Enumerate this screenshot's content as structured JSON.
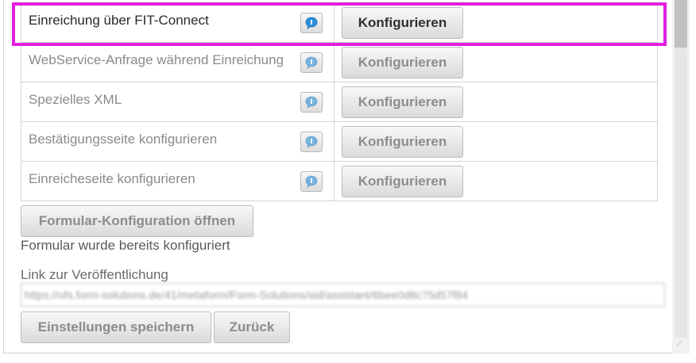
{
  "rows": [
    {
      "label": "Einreichung über FIT-Connect",
      "button": "Konfigurieren"
    },
    {
      "label": "WebService-Anfrage während Einreichung",
      "button": "Konfigurieren"
    },
    {
      "label": "Spezielles XML",
      "button": "Konfigurieren"
    },
    {
      "label": "Bestätigungsseite konfigurieren",
      "button": "Konfigurieren"
    },
    {
      "label": "Einreicheseite konfigurieren",
      "button": "Konfigurieren"
    }
  ],
  "form_config_button": "Formular-Konfiguration öffnen",
  "status_text": "Formular wurde bereits konfiguriert",
  "link": {
    "label": "Link zur Veröffentlichung",
    "value": "https://ofs.form-solutions.de/41/metaform/Form-Solutions/sid/assistant/6bee0d8c75d57f84"
  },
  "footer": {
    "save_label": "Einstellungen speichern",
    "back_label": "Zurück"
  },
  "colors": {
    "highlight": "#e21fe0",
    "info_icon": "#2a8fd8"
  },
  "icons": {
    "info": "speech-bubble-info-icon",
    "resize": "resize-grip-icon"
  }
}
